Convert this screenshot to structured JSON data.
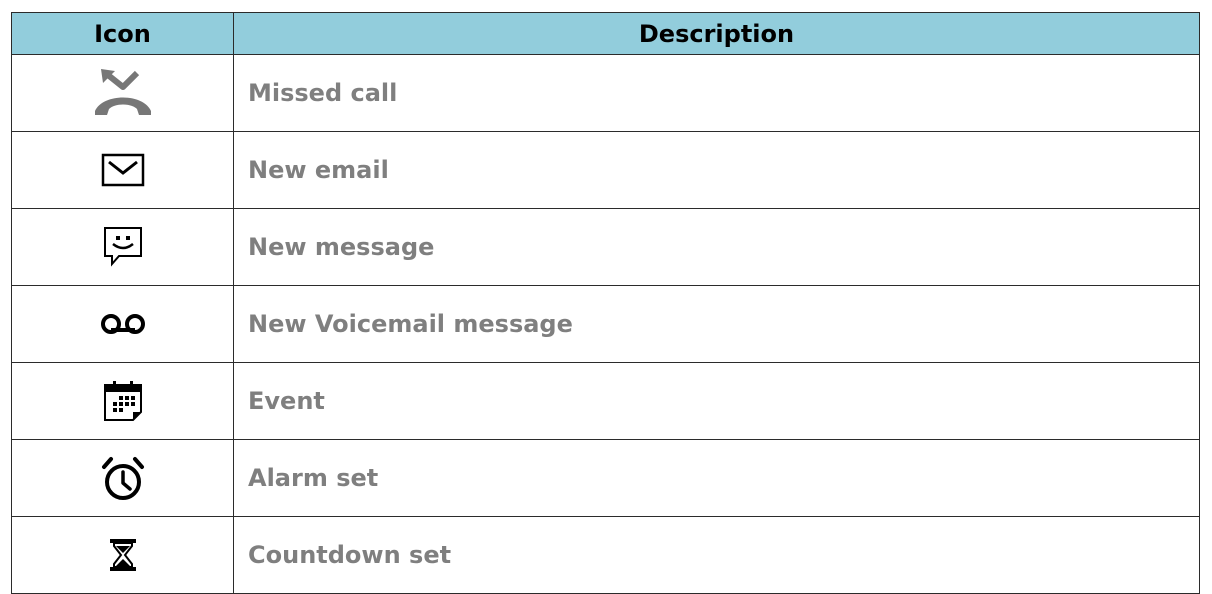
{
  "table": {
    "headers": {
      "icon": "Icon",
      "description": "Description"
    },
    "header_color": "#92cddc",
    "description_color": "#7f7f7f",
    "rows": [
      {
        "icon": "missed-call-icon",
        "description": "Missed call"
      },
      {
        "icon": "email-icon",
        "description": "New email"
      },
      {
        "icon": "message-icon",
        "description": "New message"
      },
      {
        "icon": "voicemail-icon",
        "description": "New Voicemail message"
      },
      {
        "icon": "calendar-event-icon",
        "description": "Event"
      },
      {
        "icon": "alarm-clock-icon",
        "description": "Alarm set"
      },
      {
        "icon": "hourglass-icon",
        "description": "Countdown set"
      }
    ]
  }
}
